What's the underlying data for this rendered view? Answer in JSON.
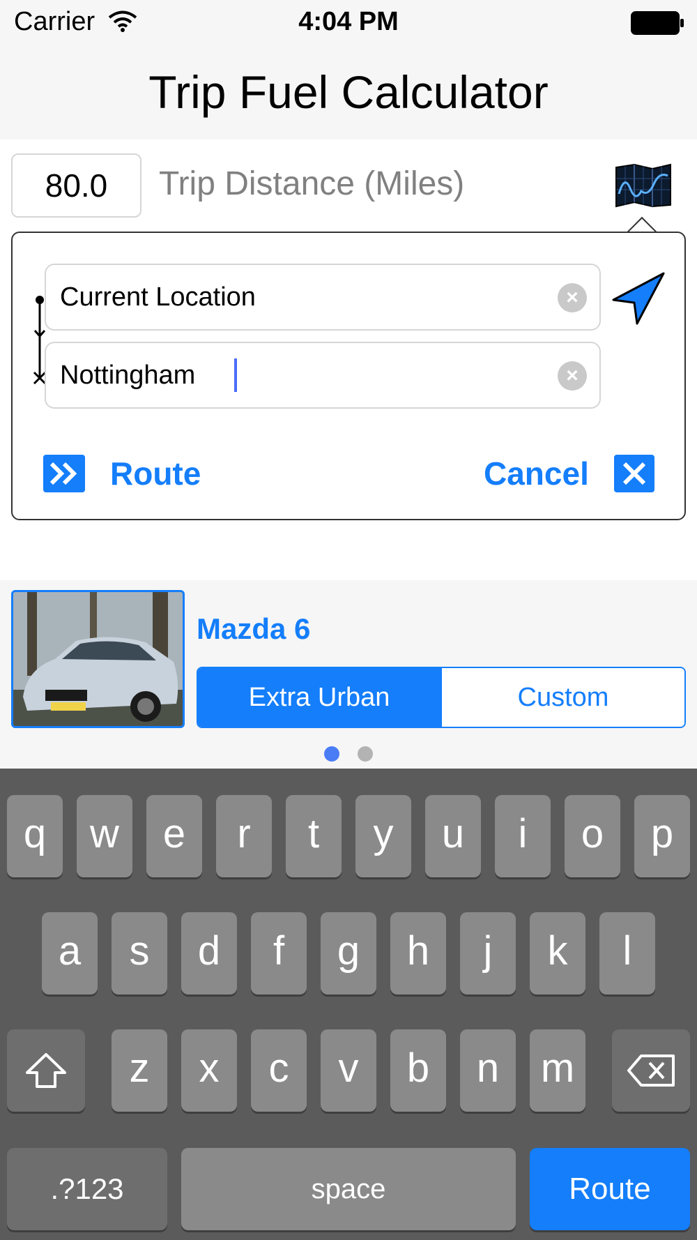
{
  "status": {
    "carrier": "Carrier",
    "time": "4:04 PM"
  },
  "nav": {
    "title": "Trip Fuel Calculator"
  },
  "trip": {
    "distance": "80.0",
    "distance_label": "Trip Distance (Miles)"
  },
  "route_form": {
    "from_value": "Current Location",
    "to_value": "Nottingham",
    "route_label": "Route",
    "cancel_label": "Cancel"
  },
  "car": {
    "name": "Mazda 6",
    "segments": [
      "Extra Urban",
      "Custom"
    ],
    "selected_segment": "Extra Urban",
    "page_count": 2,
    "current_page": 1
  },
  "keyboard": {
    "row1": [
      "q",
      "w",
      "e",
      "r",
      "t",
      "y",
      "u",
      "i",
      "o",
      "p"
    ],
    "row2": [
      "a",
      "s",
      "d",
      "f",
      "g",
      "h",
      "j",
      "k",
      "l"
    ],
    "row3": [
      "z",
      "x",
      "c",
      "v",
      "b",
      "n",
      "m"
    ],
    "numbers_label": ".?123",
    "space_label": "space",
    "return_label": "Route"
  },
  "colors": {
    "accent": "#147efb",
    "keyboard_bg": "#5b5b5b",
    "key": "#8a8a8a"
  }
}
